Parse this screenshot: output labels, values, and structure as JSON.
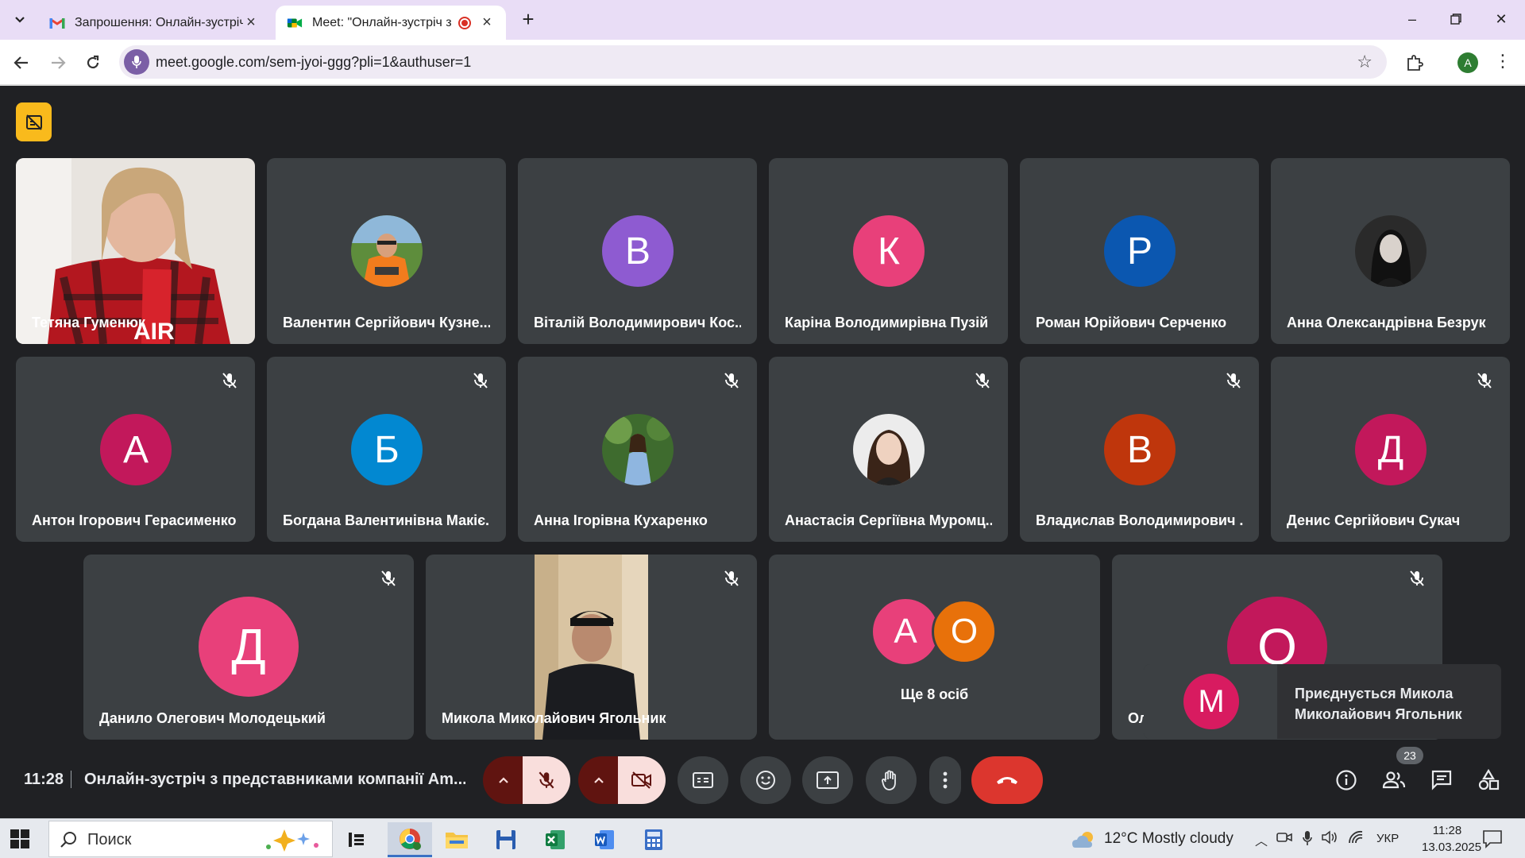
{
  "browser": {
    "tabs": [
      {
        "title": "Запрошення: Онлайн-зустріч з",
        "active": false,
        "icon": "gmail-icon"
      },
      {
        "title": "Meet: \"Онлайн-зустріч з пр",
        "active": true,
        "icon": "meet-icon",
        "recording": true
      }
    ],
    "url": "meet.google.com/sem-jyoi-ggg?pli=1&authuser=1",
    "profile_initial": "A"
  },
  "participants": {
    "row1": [
      {
        "name": "Тетяна Гуменюк",
        "type": "video"
      },
      {
        "name": "Валентин Сергійович Кузне...",
        "type": "photo"
      },
      {
        "name": "Віталій Володимирович Кос...",
        "initial": "В",
        "color": "#8e5bd1"
      },
      {
        "name": "Каріна Володимирівна Пузій",
        "initial": "К",
        "color": "#e8407a"
      },
      {
        "name": "Роман Юрійович Серченко",
        "initial": "Р",
        "color": "#0b57b0"
      },
      {
        "name": "Анна Олександрівна Безрук",
        "type": "photo"
      }
    ],
    "row2": [
      {
        "name": "Антон Ігорович Герасименко",
        "initial": "А",
        "color": "#c2185b"
      },
      {
        "name": "Богдана Валентинівна Макіє...",
        "initial": "Б",
        "color": "#0288d1"
      },
      {
        "name": "Анна Ігорівна Кухаренко",
        "type": "photo"
      },
      {
        "name": "Анастасія Сергіївна Муромц...",
        "type": "photo"
      },
      {
        "name": "Владислав Володимирович ...",
        "initial": "В",
        "color": "#bf360c"
      },
      {
        "name": "Денис Сергійович Сукач",
        "initial": "Д",
        "color": "#c2185b"
      }
    ],
    "row3": [
      {
        "name": "Данило Олегович Молодецький",
        "initial": "Д",
        "color": "#e8407a"
      },
      {
        "name": "Микола Миколайович Ягольник",
        "type": "video"
      },
      {
        "name": "Ще 8 осіб",
        "initials": [
          "А",
          "О"
        ],
        "colors": [
          "#e8407a",
          "#e8710a"
        ]
      },
      {
        "name": "Ол",
        "initial": "О",
        "color": "#c2185b"
      }
    ]
  },
  "toast": {
    "initial": "М",
    "text": "Приєднується Микола Миколайович Ягольник"
  },
  "controls": {
    "time": "11:28",
    "meeting_title": "Онлайн-зустріч з представниками компанії Am...",
    "people_count": "23"
  },
  "taskbar": {
    "search_placeholder": "Поиск",
    "weather": "12°C  Mostly cloudy",
    "language": "УКР",
    "time": "11:28",
    "date": "13.03.2025"
  }
}
